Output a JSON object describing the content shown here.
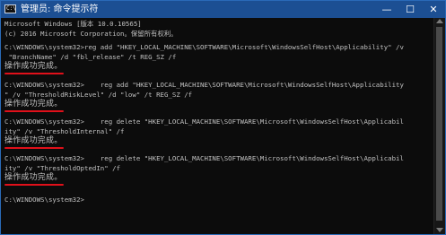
{
  "window": {
    "icon_text": "C:\\",
    "title": "管理员: 命令提示符",
    "minimize_glyph": "—",
    "maximize_glyph": "☐",
    "close_glyph": "✕"
  },
  "console": {
    "lines": [
      "Microsoft Windows [版本 10.0.10565]",
      "(c) 2016 Microsoft Corporation。保留所有权利。",
      "",
      "C:\\WINDOWS\\system32>reg add \"HKEY_LOCAL_MACHINE\\SOFTWARE\\Microsoft\\WindowsSelfHost\\Applicability\" /v",
      " \"BranchName\" /d \"fbl_release\" /t REG_SZ /f",
      "操作成功完成。",
      "",
      "C:\\WINDOWS\\system32>    reg add \"HKEY_LOCAL_MACHINE\\SOFTWARE\\Microsoft\\WindowsSelfHost\\Applicability",
      "\" /v \"ThresholdRiskLevel\" /d \"low\" /t REG_SZ /f",
      "操作成功完成。",
      "",
      "C:\\WINDOWS\\system32>    reg delete \"HKEY_LOCAL_MACHINE\\SOFTWARE\\Microsoft\\WindowsSelfHost\\Applicabil",
      "ity\" /v \"ThresholdInternal\" /f",
      "操作成功完成。",
      "",
      "C:\\WINDOWS\\system32>    reg delete \"HKEY_LOCAL_MACHINE\\SOFTWARE\\Microsoft\\WindowsSelfHost\\Applicabil",
      "ity\" /v \"ThresholdOptedIn\" /f",
      "操作成功完成。",
      "",
      "C:\\WINDOWS\\system32>"
    ]
  },
  "colors": {
    "titlebar": "#1c4f93",
    "console_bg": "#0c0c0c",
    "console_text": "#c0c0c0",
    "highlight_underline": "#e0101a"
  }
}
